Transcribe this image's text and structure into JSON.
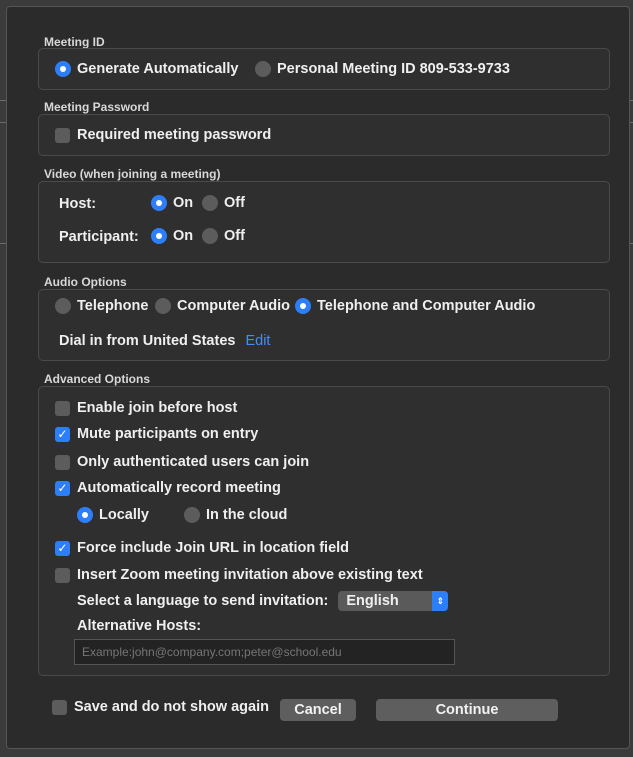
{
  "meeting_id": {
    "title": "Meeting ID",
    "options": [
      {
        "label": "Generate Automatically",
        "selected": true
      },
      {
        "label": "Personal Meeting ID 809-533-9733",
        "selected": false
      }
    ]
  },
  "password": {
    "title": "Meeting Password",
    "required_label": "Required meeting password",
    "required": false
  },
  "video": {
    "title": "Video (when joining a meeting)",
    "host_label": "Host:",
    "participant_label": "Participant:",
    "on_label": "On",
    "off_label": "Off",
    "host_value": "On",
    "participant_value": "On"
  },
  "audio": {
    "title": "Audio Options",
    "options": [
      {
        "label": "Telephone",
        "selected": false
      },
      {
        "label": "Computer Audio",
        "selected": false
      },
      {
        "label": "Telephone and Computer Audio",
        "selected": true
      }
    ],
    "dial_in_label": "Dial in from United States",
    "edit_label": "Edit"
  },
  "advanced": {
    "title": "Advanced Options",
    "enable_join_before_host": {
      "label": "Enable join before host",
      "checked": false
    },
    "mute_on_entry": {
      "label": "Mute participants on entry",
      "checked": true
    },
    "only_authenticated": {
      "label": "Only authenticated users can join",
      "checked": false
    },
    "auto_record": {
      "label": "Automatically record meeting",
      "checked": true
    },
    "record_locally": {
      "label": "Locally",
      "selected": true
    },
    "record_cloud": {
      "label": "In the cloud",
      "selected": false
    },
    "force_join_url": {
      "label": "Force include Join URL in location field",
      "checked": true
    },
    "insert_invitation": {
      "label": "Insert Zoom meeting invitation above existing text",
      "checked": false
    },
    "language_label": "Select a language to send invitation:",
    "language_value": "English",
    "alt_hosts_label": "Alternative Hosts:",
    "alt_hosts_placeholder": "Example:john@company.com;peter@school.edu",
    "alt_hosts_value": ""
  },
  "footer": {
    "save_label": "Save and do not show again",
    "save_checked": false,
    "cancel_label": "Cancel",
    "continue_label": "Continue"
  },
  "colors": {
    "accent": "#2d7ff9",
    "background": "#2b2b2b"
  }
}
